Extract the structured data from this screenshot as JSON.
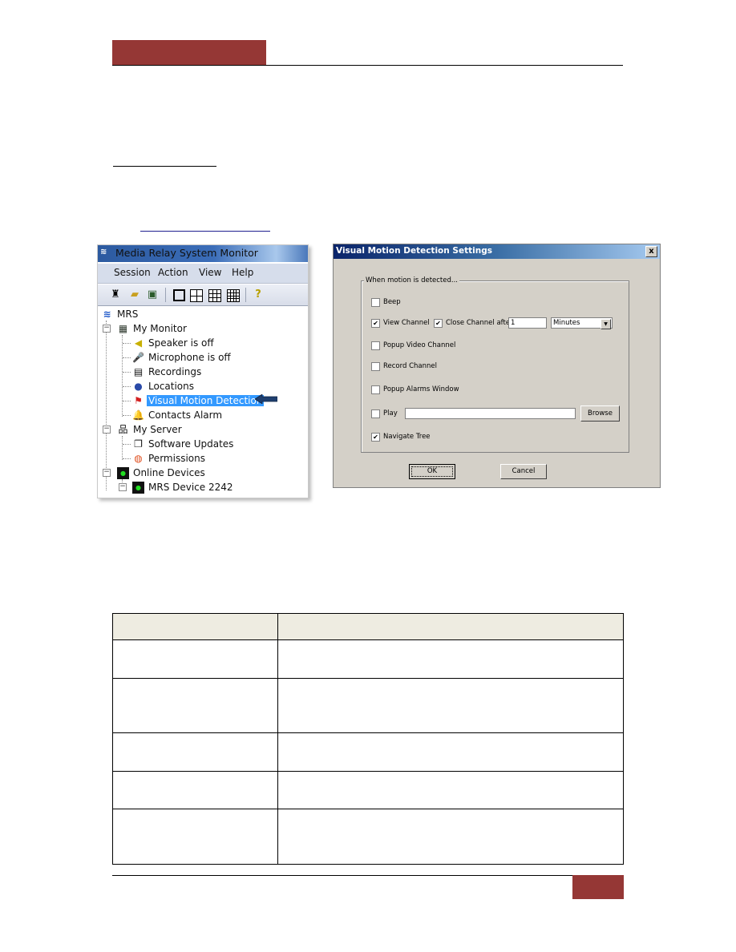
{
  "page": {
    "header_color": "#953735",
    "footer_color": "#953735"
  },
  "tree_window": {
    "title": "Media Relay System Monitor",
    "menu": [
      "Session",
      "Action",
      "View",
      "Help"
    ],
    "toolbar": [
      "flashlight-icon",
      "open-folder-icon",
      "save-icon",
      "single-view-icon",
      "quad-view-icon",
      "nine-view-icon",
      "sixteen-view-icon",
      "help-icon"
    ],
    "nodes": [
      {
        "label": "MRS",
        "icon": "mrs-logo-icon"
      },
      {
        "label": "My Monitor",
        "icon": "monitor-icon"
      },
      {
        "label": "Speaker is off",
        "icon": "speaker-icon"
      },
      {
        "label": "Microphone is off",
        "icon": "microphone-icon"
      },
      {
        "label": "Recordings",
        "icon": "recordings-icon"
      },
      {
        "label": "Locations",
        "icon": "globe-icon"
      },
      {
        "label": "Visual Motion Detection",
        "icon": "motion-alarm-icon",
        "selected": true
      },
      {
        "label": "Contacts Alarm",
        "icon": "contacts-alarm-icon"
      },
      {
        "label": "My Server",
        "icon": "server-icon"
      },
      {
        "label": "Software Updates",
        "icon": "updates-icon"
      },
      {
        "label": "Permissions",
        "icon": "permissions-icon"
      },
      {
        "label": "Online Devices",
        "icon": "device-icon"
      },
      {
        "label": "MRS Device 2242",
        "icon": "device-icon"
      }
    ],
    "selection_color": "#3399ff"
  },
  "dialog": {
    "title": "Visual Motion Detection Settings",
    "close_label": "x",
    "group_label": "When motion is detected...",
    "options": {
      "beep": {
        "label": "Beep",
        "checked": false
      },
      "view_channel": {
        "label": "View Channel",
        "checked": true
      },
      "close_channel_after": {
        "label": "Close Channel after",
        "checked": true,
        "value": "1",
        "unit": "Minutes"
      },
      "popup_video_channel": {
        "label": "Popup Video Channel",
        "checked": false
      },
      "record_channel": {
        "label": "Record Channel",
        "checked": false
      },
      "popup_alarms_window": {
        "label": "Popup Alarms Window",
        "checked": false
      },
      "play": {
        "label": "Play",
        "checked": false,
        "value": ""
      },
      "navigate_tree": {
        "label": "Navigate Tree",
        "checked": true
      }
    },
    "browse_label": "Browse",
    "ok_label": "OK",
    "cancel_label": "Cancel",
    "check_mark": "✔"
  },
  "table": {
    "headers": [
      "",
      ""
    ],
    "rows": [
      [
        "",
        ""
      ],
      [
        "",
        ""
      ],
      [
        "",
        ""
      ],
      [
        "",
        ""
      ],
      [
        "",
        ""
      ]
    ]
  }
}
